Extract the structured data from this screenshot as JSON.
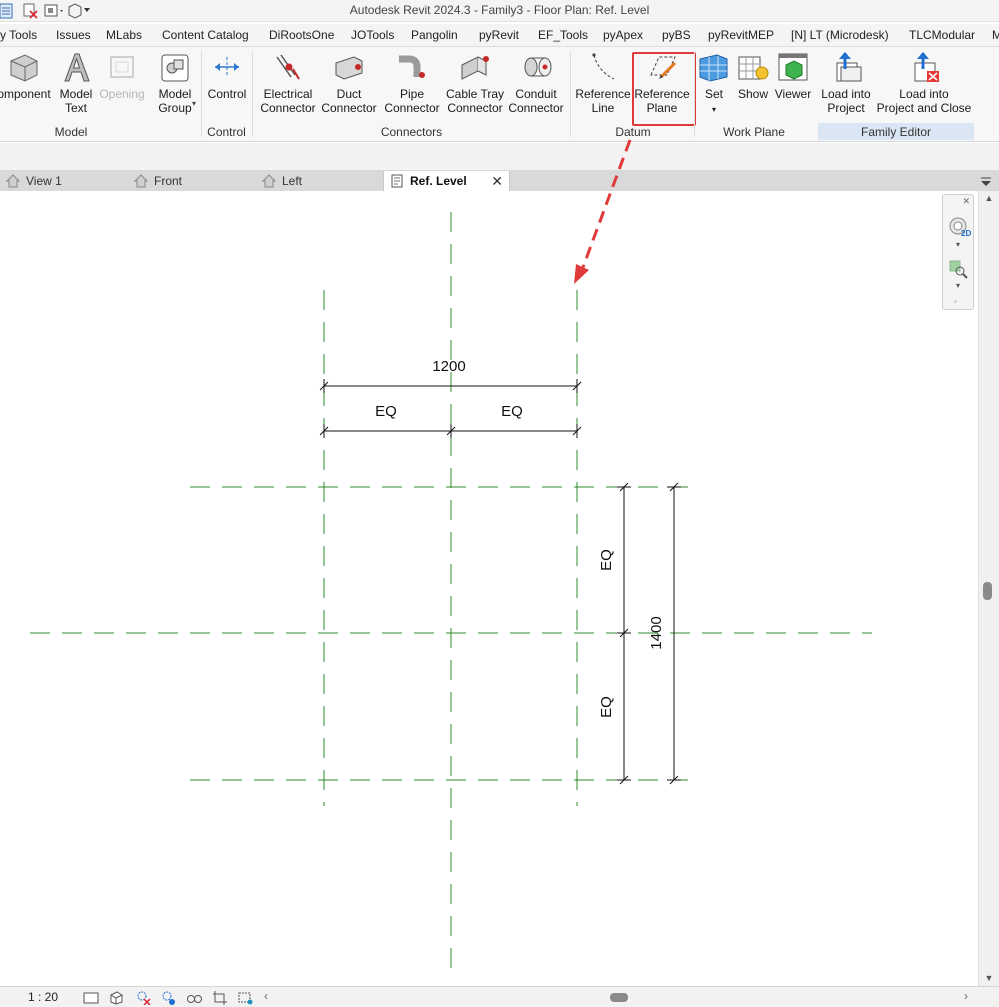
{
  "app": {
    "title": "Autodesk Revit 2024.3 - Family3 - Floor Plan: Ref. Level"
  },
  "ribbon_tabs": [
    "y Tools",
    "Issues",
    "MLabs",
    "Content Catalog",
    "DiRootsOne",
    "JOTools",
    "Pangolin",
    "pyRevit",
    "EF_Tools",
    "pyApex",
    "pyBS",
    "pyRevitMEP",
    "[N] LT (Microdesk)",
    "TLCModular",
    "M"
  ],
  "ribbon": {
    "component": [
      "omponent"
    ],
    "model_text": [
      "Model",
      "Text"
    ],
    "opening": [
      "Opening"
    ],
    "model_group": [
      "Model",
      "Group"
    ],
    "control": [
      "Control"
    ],
    "electrical_connector": [
      "Electrical",
      "Connector"
    ],
    "duct_connector": [
      "Duct",
      "Connector"
    ],
    "pipe_connector": [
      "Pipe",
      "Connector"
    ],
    "cable_tray_connector": [
      "Cable Tray",
      "Connector"
    ],
    "conduit_connector": [
      "Conduit",
      "Connector"
    ],
    "reference_line": [
      "Reference",
      "Line"
    ],
    "reference_plane": [
      "Reference",
      "Plane"
    ],
    "set": [
      "Set"
    ],
    "show": [
      "Show"
    ],
    "viewer": [
      "Viewer"
    ],
    "load_into_project": [
      "Load into",
      "Project"
    ],
    "load_into_project_close": [
      "Load into",
      "Project and Close"
    ],
    "panels": {
      "model": "Model",
      "control": "Control",
      "connectors": "Connectors",
      "datum": "Datum",
      "work_plane": "Work Plane",
      "family_editor": "Family Editor"
    },
    "highlight_color": "#e03a3a"
  },
  "view_tabs": [
    {
      "label": "View 1",
      "icon": "house-icon",
      "active": false
    },
    {
      "label": "Front",
      "icon": "elevation-icon",
      "active": false
    },
    {
      "label": "Left",
      "icon": "elevation-icon",
      "active": false
    },
    {
      "label": "Ref. Level",
      "icon": "floor-plan-icon",
      "active": true
    }
  ],
  "drawing": {
    "dimensions": {
      "overall_horizontal": "1200",
      "eq_left": "EQ",
      "eq_right": "EQ",
      "overall_vertical": "1400",
      "eq_top": "EQ",
      "eq_bottom": "EQ"
    },
    "reference_plane_color": "#2e8b2e",
    "annotation_arrow_color": "#e03a3a"
  },
  "statusbar": {
    "scale": "1 : 20"
  }
}
